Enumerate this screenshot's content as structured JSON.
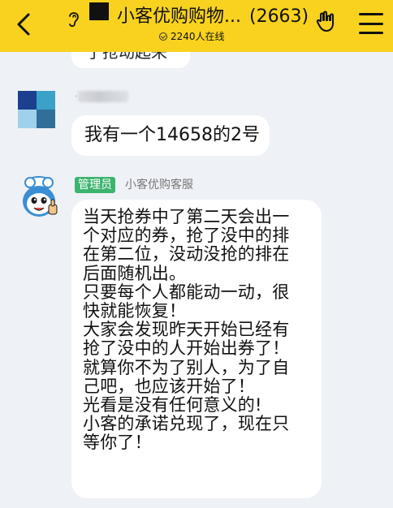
{
  "header": {
    "title": "小客优购购物...",
    "member_count": "(2663)",
    "online_text": "2240人在线",
    "background_color": "#f8d21e"
  },
  "messages": [
    {
      "sender_visible": false,
      "partial_text": "了抢动起来"
    },
    {
      "text": "我有一个14658的2号"
    },
    {
      "badge": "管理员",
      "sender_name": "小客优购客服",
      "lines": [
        "当天抢券中了第二天会出一",
        "个对应的券，抢了没中的排",
        "在第二位，没动没抢的排在",
        "后面随机出。",
        "只要每个人都能动一动，很",
        "快就能恢复！",
        "大家会发现昨天开始已经有",
        "抢了没中的人开始出券了！",
        "就算你不为了别人，为了自",
        "己吧，也应该开始了！",
        "光看是没有任何意义的!",
        "小客的承诺兑现了，现在只",
        "等你了！"
      ]
    }
  ],
  "icons": {
    "back": "chevron-left-icon",
    "voice": "ear-icon",
    "sticker": "hand-gesture-icon",
    "menu": "menu-icon"
  }
}
